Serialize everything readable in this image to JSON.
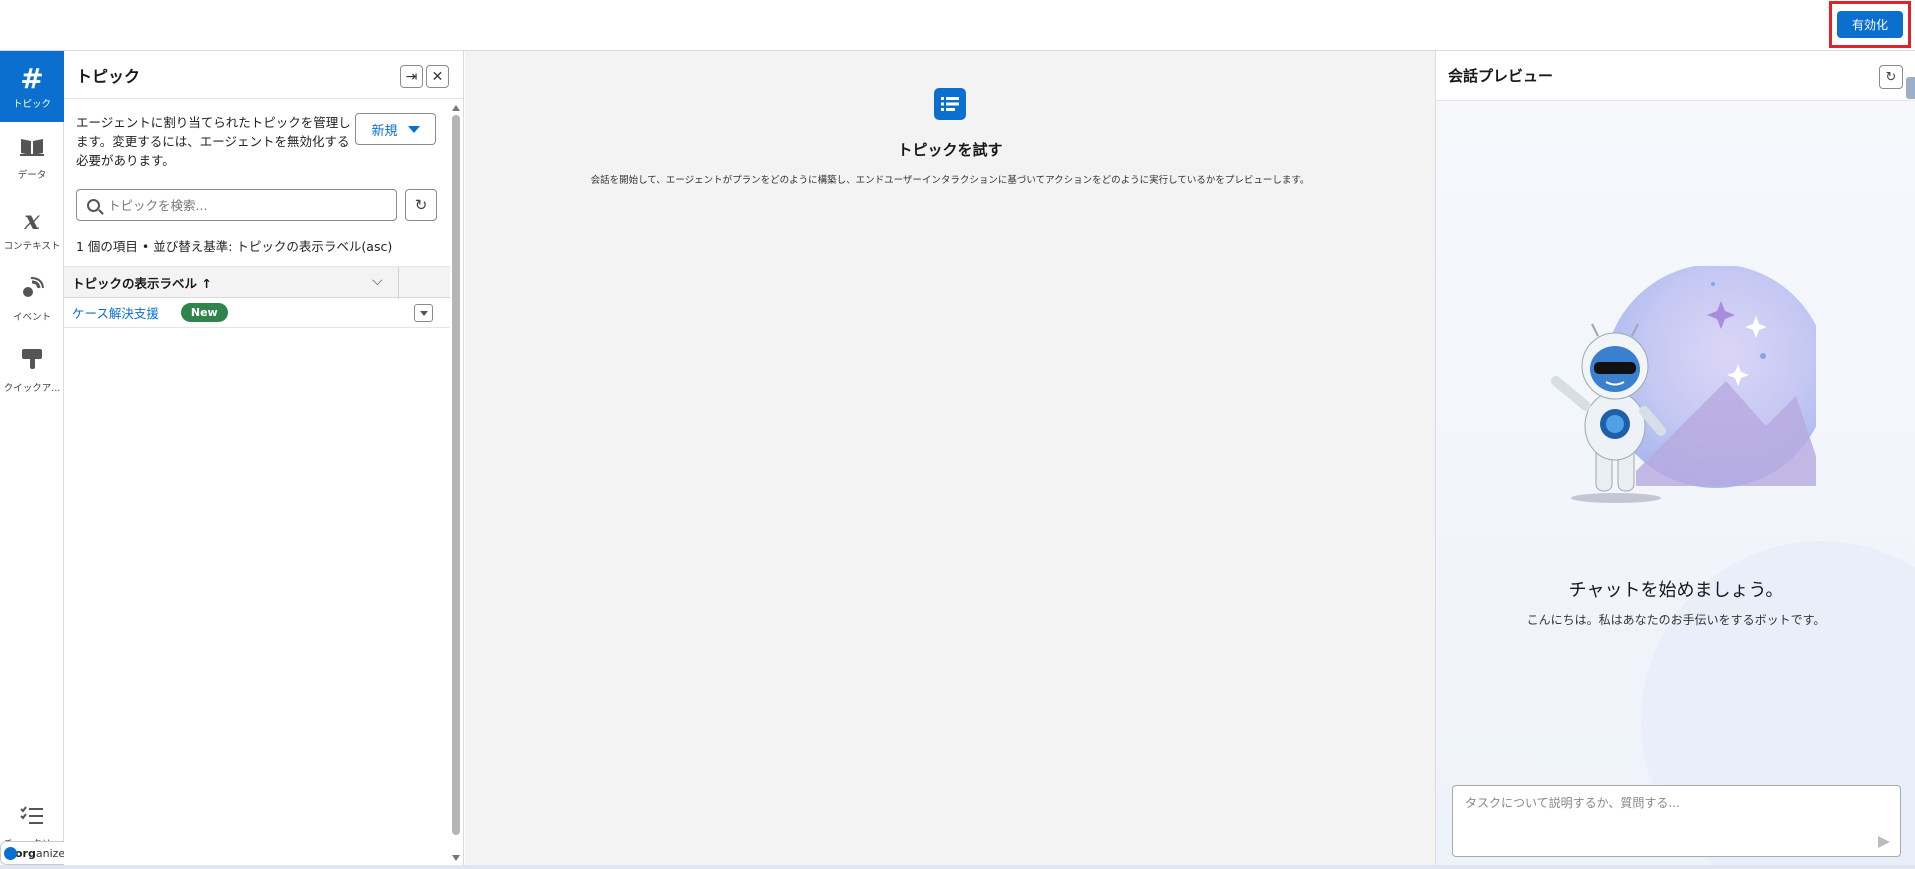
{
  "header": {
    "activate_label": "有効化"
  },
  "rail": {
    "items": [
      {
        "label": "トピック",
        "icon": "hash-icon",
        "glyph": "#",
        "active": true
      },
      {
        "label": "データ",
        "icon": "book-icon",
        "glyph": "📖",
        "active": false
      },
      {
        "label": "コンテキスト",
        "icon": "variable-x-icon",
        "glyph": "x",
        "active": false
      },
      {
        "label": "イベント",
        "icon": "signal-icon",
        "glyph": "◍",
        "active": false
      },
      {
        "label": "クイックア...",
        "icon": "quick-action-icon",
        "glyph": "☝",
        "active": false
      }
    ],
    "checklist_label": "チェックリ...",
    "organizer_prefix": "org",
    "organizer_suffix": "anizer"
  },
  "topics": {
    "title": "トピック",
    "description": "エージェントに割り当てられたトピックを管理します。変更するには、エージェントを無効化する必要があります。",
    "new_label": "新規",
    "search_placeholder": "トピックを検索...",
    "count_text": "1 個の項目 • 並び替え基準: トピックの表示ラベル(asc)",
    "column_header": "トピックの表示ラベル ↑",
    "rows": [
      {
        "label": "ケース解決支援",
        "badge": "New"
      }
    ]
  },
  "center": {
    "title": "トピックを試す",
    "description": "会話を開始して、エージェントがプランをどのように構築し、エンドユーザーインタラクションに基づいてアクションをどのように実行しているかをプレビューします。"
  },
  "preview": {
    "title": "会話プレビュー",
    "heading": "チャットを始めましょう。",
    "subtext": "こんにちは。私はあなたのお手伝いをするボットです。",
    "input_placeholder": "タスクについて説明するか、質問する..."
  },
  "colors": {
    "brand": "#0b6fd0",
    "highlight_border": "#e0222b",
    "badge_green": "#2e844a"
  }
}
